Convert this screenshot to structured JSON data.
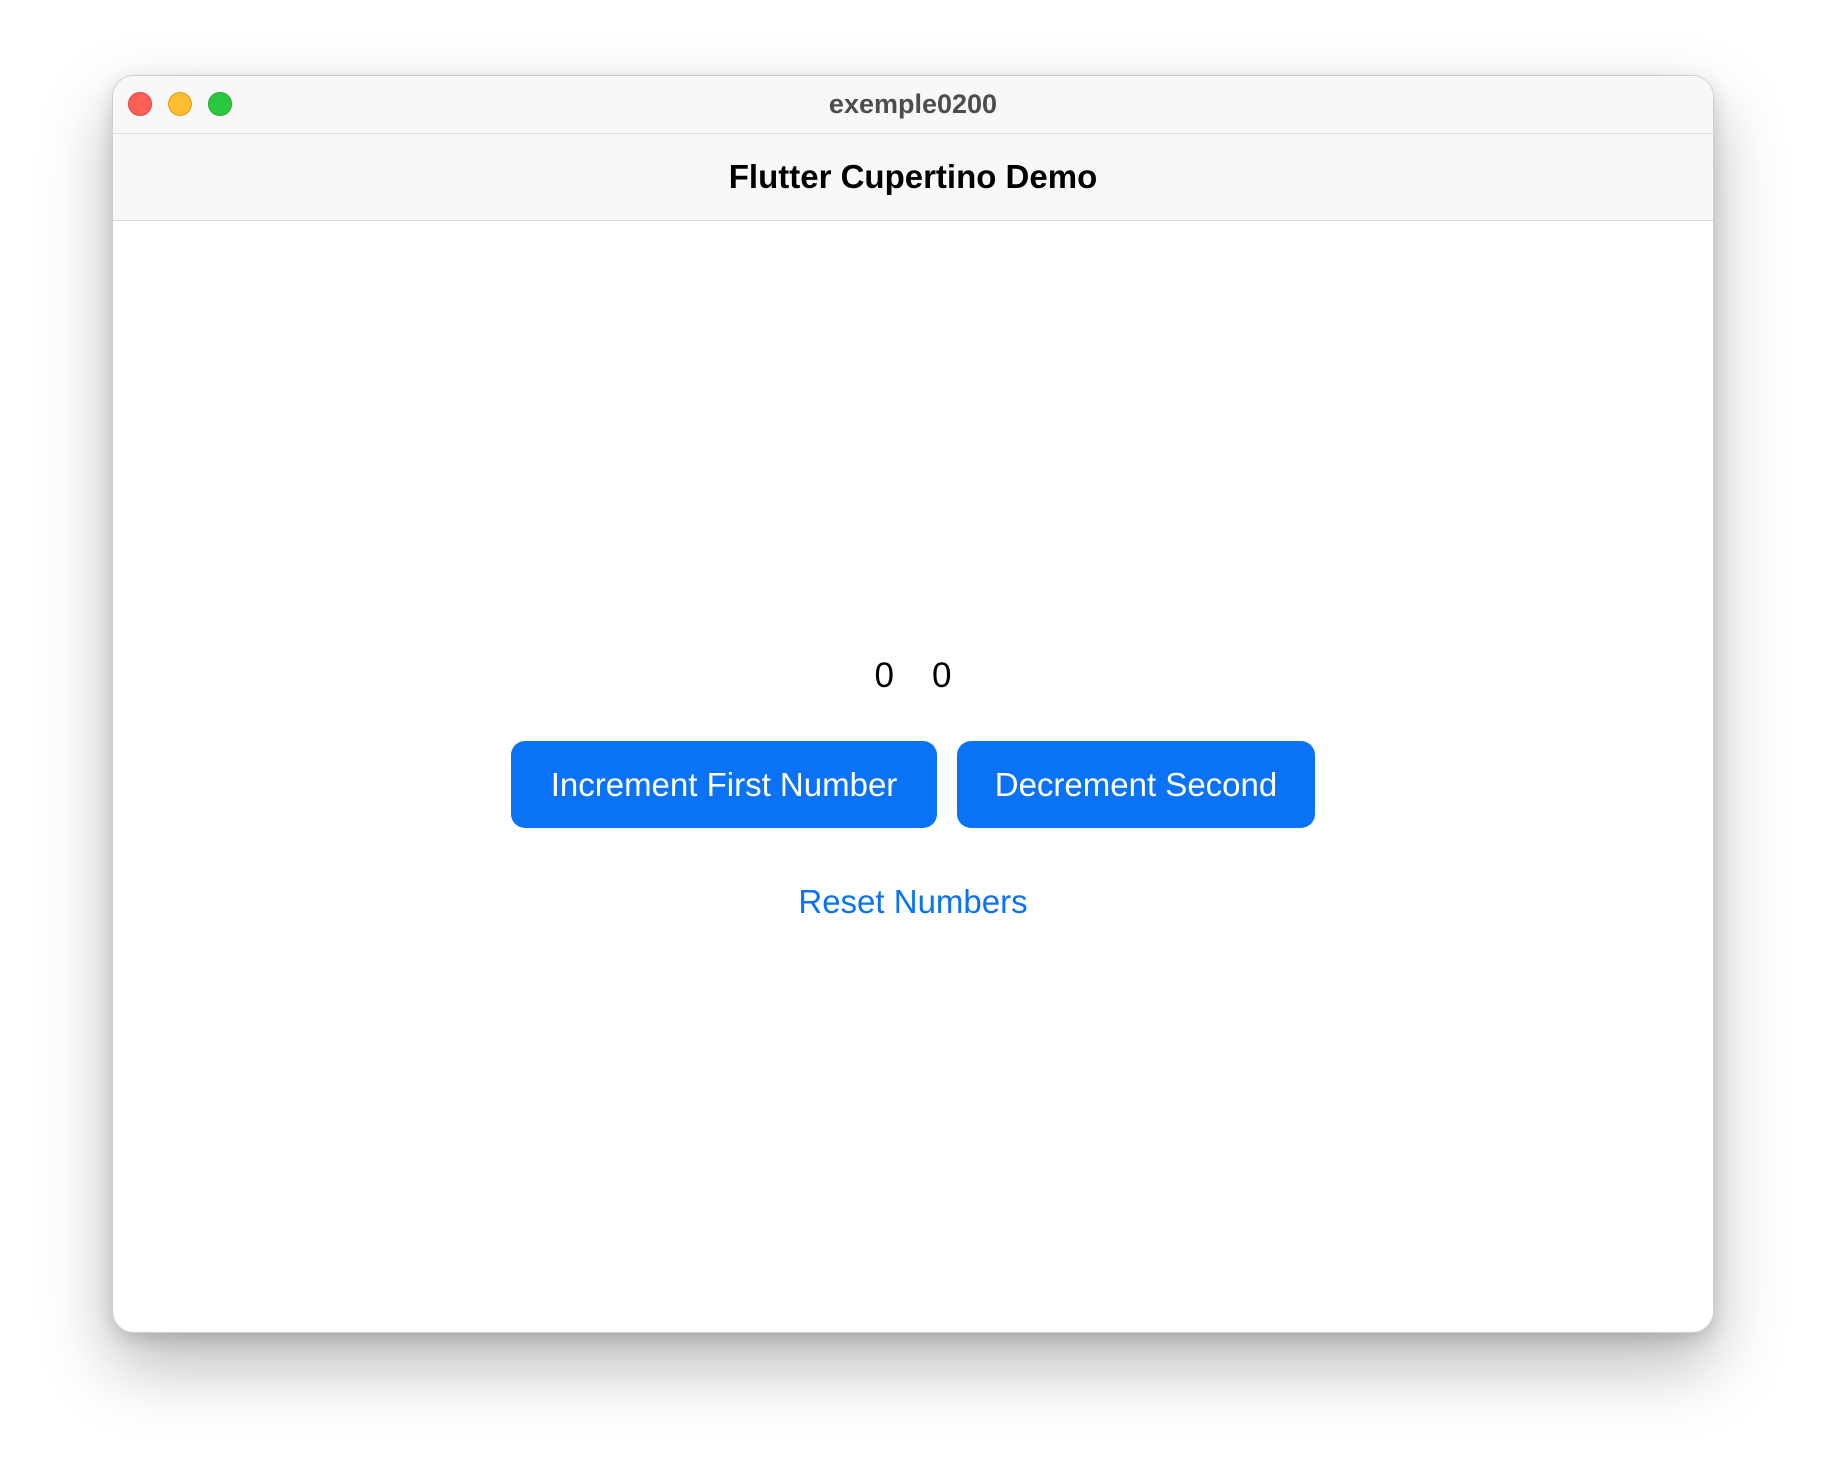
{
  "window": {
    "title": "exemple0200"
  },
  "navbar": {
    "title": "Flutter Cupertino Demo"
  },
  "counters": {
    "first": "0",
    "second": "0"
  },
  "buttons": {
    "increment_first": "Increment First Number",
    "decrement_second": "Decrement Second",
    "reset": "Reset Numbers"
  },
  "colors": {
    "accent": "#0a72f5",
    "close": "#fe5f57",
    "minimize": "#febc2e",
    "maximize": "#28c840"
  }
}
